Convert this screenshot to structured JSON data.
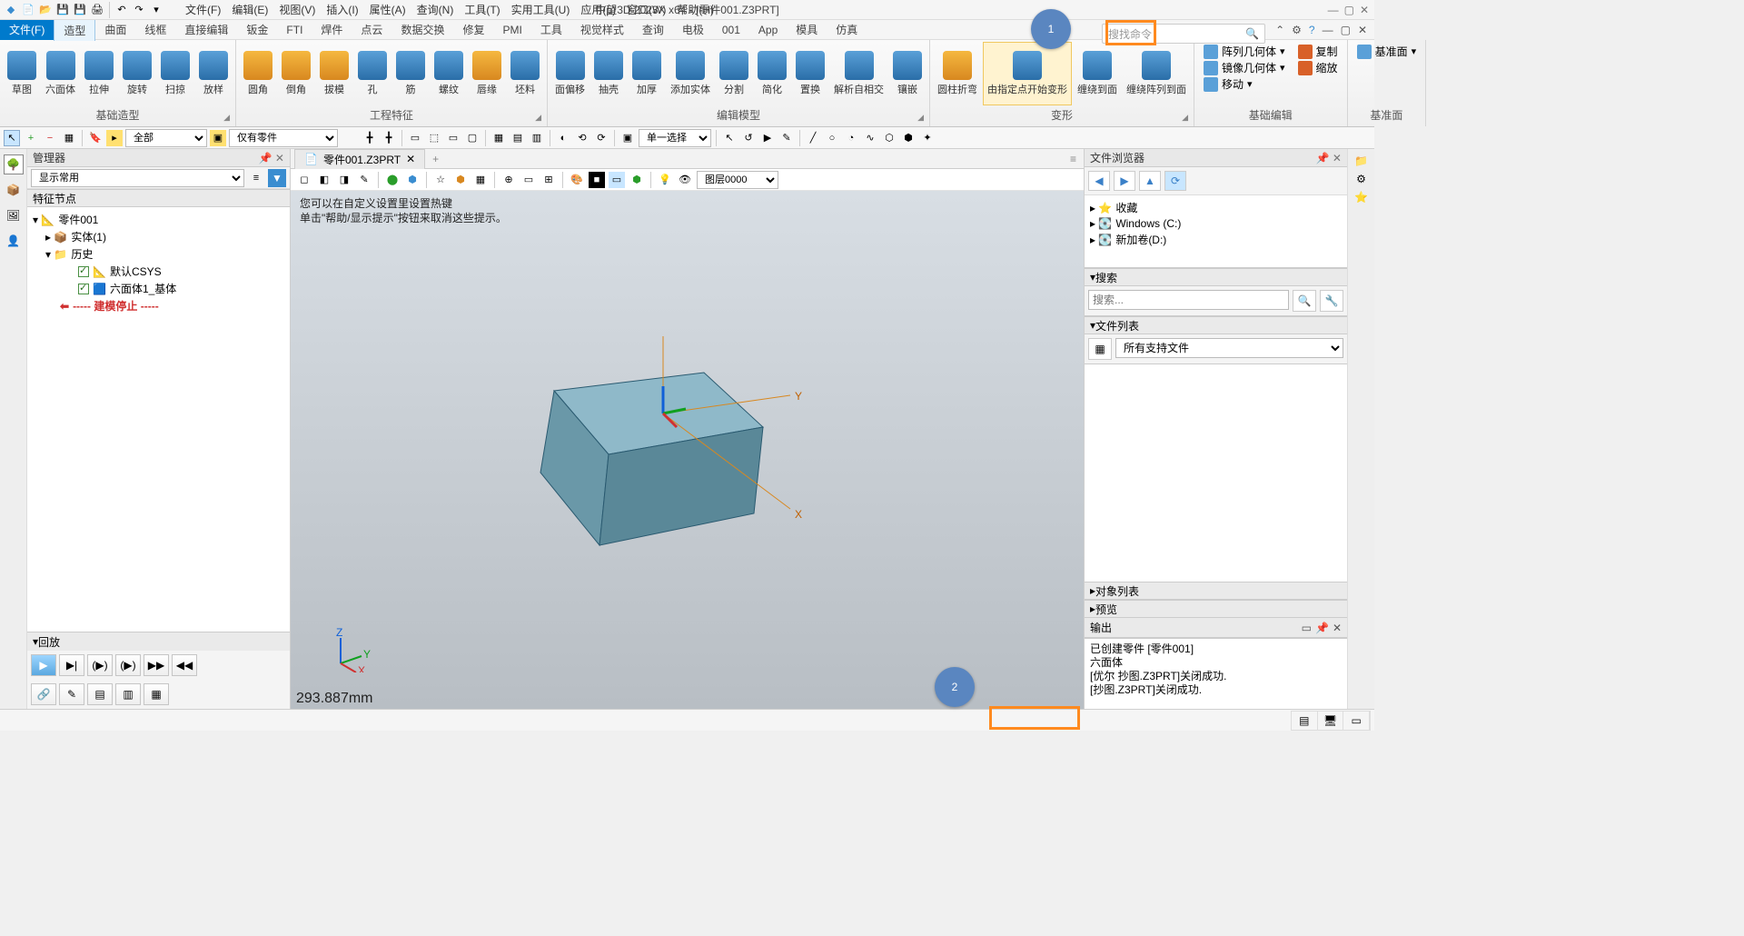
{
  "app": {
    "title": "中望3D 2023X x64 - [零件001.Z3PRT]",
    "search_placeholder": "搜找命令"
  },
  "menu": [
    "文件(F)",
    "编辑(E)",
    "视图(V)",
    "插入(I)",
    "属性(A)",
    "查询(N)",
    "工具(T)",
    "实用工具(U)",
    "应用(p)",
    "窗口(W)",
    "帮助(H)"
  ],
  "ribbon_tabs": {
    "file": "文件(F)",
    "items": [
      "造型",
      "曲面",
      "线框",
      "直接编辑",
      "钣金",
      "FTI",
      "焊件",
      "点云",
      "数据交换",
      "修复",
      "PMI",
      "工具",
      "视觉样式",
      "查询",
      "电极",
      "001",
      "App",
      "模具",
      "仿真"
    ],
    "active": "造型"
  },
  "ribbon": {
    "g1": {
      "title": "基础造型",
      "btns": [
        "草图",
        "六面体",
        "拉伸",
        "旋转",
        "扫掠",
        "放样"
      ]
    },
    "g2": {
      "title": "工程特征",
      "btns": [
        "圆角",
        "倒角",
        "拔模",
        "孔",
        "筋",
        "螺纹",
        "唇缘",
        "坯料"
      ]
    },
    "g3": {
      "title": "编辑模型",
      "btns": [
        "面偏移",
        "抽壳",
        "加厚",
        "添加实体",
        "分割",
        "简化",
        "置换",
        "解析自相交",
        "镶嵌"
      ]
    },
    "g4": {
      "title": "变形",
      "btns": [
        "圆柱折弯",
        "由指定点开始变形",
        "缠绕到面",
        "缠绕阵列到面"
      ]
    },
    "g5": {
      "title": "基础编辑",
      "pattern": "阵列几何体",
      "copy": "复制",
      "mirror": "镜像几何体",
      "scale": "缩放",
      "move": "移动"
    },
    "g6": {
      "title": "基准面",
      "btn": "基准面"
    }
  },
  "toolrow": {
    "filter1_label": "全部",
    "filter2_label": "仅有零件",
    "pick_label": "单一选择"
  },
  "manager": {
    "title": "管理器",
    "display_mode": "显示常用",
    "feature_section": "特征节点",
    "tree_root": "零件001",
    "tree_solid": "实体(1)",
    "tree_history": "历史",
    "tree_csys": "默认CSYS",
    "tree_cube": "六面体1_基体",
    "tree_stop": "----- 建模停止 -----",
    "playback": "回放"
  },
  "doc": {
    "tab": "零件001.Z3PRT"
  },
  "canvas": {
    "hint1": "您可以在自定义设置里设置热键",
    "hint2": "单击\"帮助/显示提示\"按钮来取消这些提示。",
    "axes": {
      "x": "X",
      "y": "Y",
      "z": "Z"
    },
    "readout": "293.887mm",
    "layer_label": "图层0000",
    "badges": {
      "one": "1",
      "two": "2"
    }
  },
  "right": {
    "title": "文件浏览器",
    "fav": "收藏",
    "drive_c": "Windows (C:)",
    "drive_d": "新加卷(D:)",
    "search_section": "搜索",
    "search_placeholder": "搜索...",
    "filelist_section": "文件列表",
    "filelist_filter": "所有支持文件",
    "objlist": "对象列表",
    "preview": "预览",
    "output": "输出",
    "out1": "已创建零件 [零件001]",
    "out2": "六面体",
    "out3": "[优尔 抄图.Z3PRT]关闭成功.",
    "out4": "[抄图.Z3PRT]关闭成功."
  },
  "chart_data": null
}
